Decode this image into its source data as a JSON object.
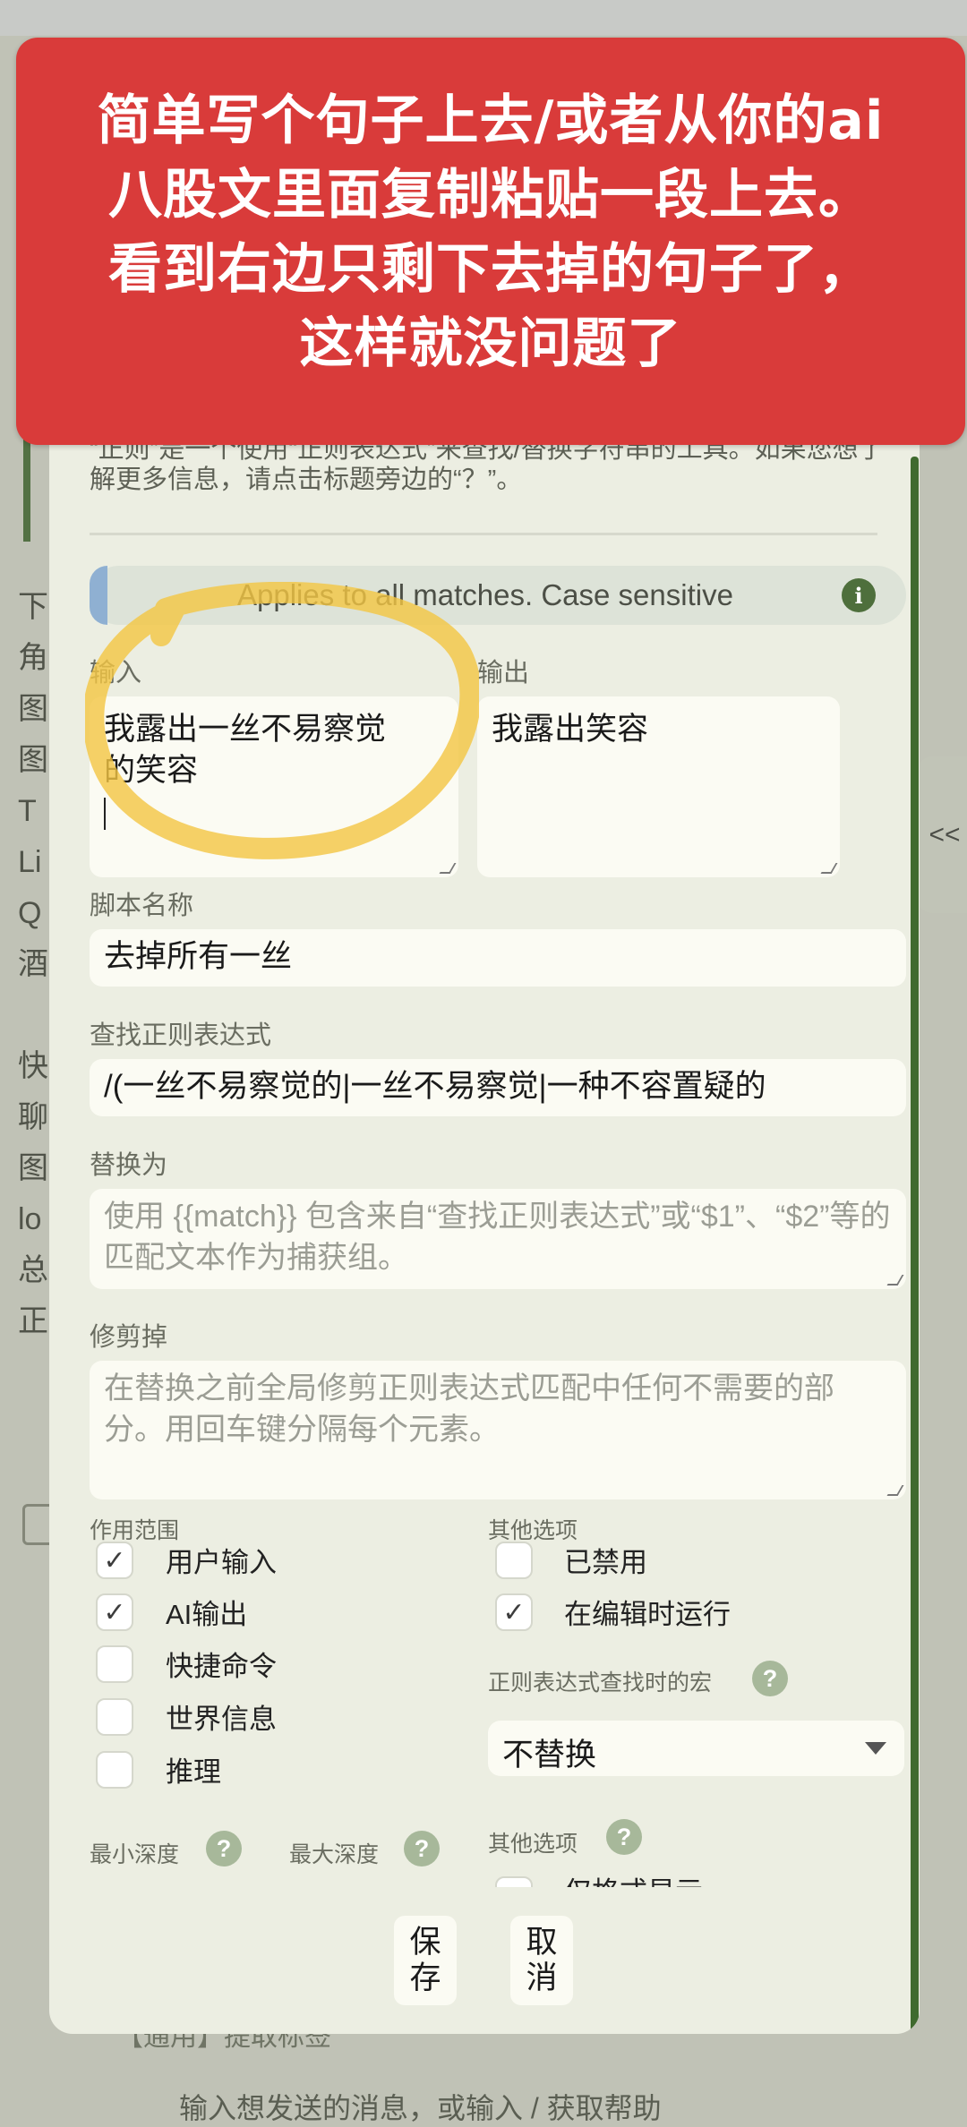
{
  "overlay": {
    "lines": [
      "简单写个句子上去/或者从你的ai",
      "八股文里面复制粘贴一段上去。",
      "看到右边只剩下去掉的句子了，",
      "这样就没问题了"
    ],
    "color": "#d93b3a"
  },
  "background": {
    "left_letters": [
      "下",
      "角",
      "图",
      "图",
      "T",
      "Li",
      "Q",
      "酒",
      "",
      "快",
      "聊",
      "图",
      "lo",
      "总",
      "正"
    ],
    "side_tab": "<<",
    "bottom_row": "【通用】提取标签",
    "bottom_row2": "输入想发送的消息，或输入 / 获取帮助"
  },
  "dialog": {
    "intro": "“正则”是一个使用“正则表达式”来查找/替换字符串的工具。如果您想了解更多信息，请点击标题旁边的“？”。",
    "info_banner": "Applies to all matches. Case sensitive",
    "input": {
      "label": "输入",
      "value_line1": "我露出一丝不易察觉",
      "value_line2": "的笑容"
    },
    "output": {
      "label": "输出",
      "value": "我露出笑容"
    },
    "script_name": {
      "label": "脚本名称",
      "value": "去掉所有一丝"
    },
    "find_regex": {
      "label": "查找正则表达式",
      "value": "/(一丝不易察觉的|一丝不易察觉|一种不容置疑的"
    },
    "replace_with": {
      "label": "替换为",
      "placeholder": "使用 {{match}} 包含来自“查找正则表达式”或“$1”、“$2”等的匹配文本作为捕获组。"
    },
    "trim_out": {
      "label": "修剪掉",
      "placeholder": "在替换之前全局修剪正则表达式匹配中任何不需要的部分。用回车键分隔每个元素。"
    },
    "scope": {
      "label": "作用范围",
      "items": [
        {
          "label": "用户输入",
          "checked": true
        },
        {
          "label": "AI输出",
          "checked": true
        },
        {
          "label": "快捷命令",
          "checked": false
        },
        {
          "label": "世界信息",
          "checked": false
        },
        {
          "label": "推理",
          "checked": false
        }
      ]
    },
    "other_options": {
      "label": "其他选项",
      "items": [
        {
          "label": "已禁用",
          "checked": false
        },
        {
          "label": "在编辑时运行",
          "checked": true
        }
      ]
    },
    "macro_label": "正则表达式查找时的宏",
    "macro_select": "不替换",
    "min_depth": "最小深度",
    "max_depth": "最大深度",
    "other_options2": "其他选项",
    "other_options2_partial": "仅格式显示",
    "save_button": [
      "保",
      "存"
    ],
    "cancel_button": [
      "取",
      "消"
    ]
  }
}
